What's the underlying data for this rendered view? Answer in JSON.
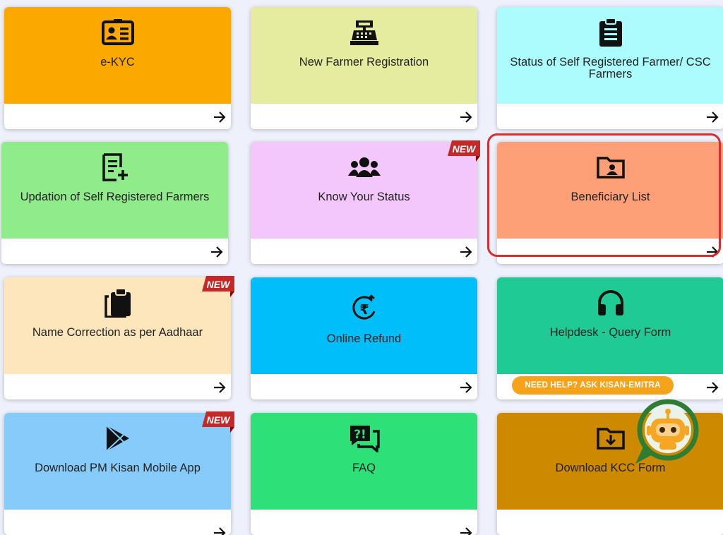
{
  "cards": [
    {
      "label": "e-KYC",
      "color": "#fba800",
      "icon": "id-card-icon"
    },
    {
      "label": "New Farmer Registration",
      "color": "#e6ec9f",
      "icon": "cash-register-icon"
    },
    {
      "label": "Status of Self Registered Farmer/ CSC Farmers",
      "color": "#adfcfd",
      "icon": "clipboard-list-icon"
    },
    {
      "label": "Updation of Self Registered Farmers",
      "color": "#90ec8a",
      "icon": "document-add-icon"
    },
    {
      "label": "Know Your Status",
      "color": "#f3c7fb",
      "icon": "users-group-icon",
      "badge": "NEW"
    },
    {
      "label": "Beneficiary List",
      "color": "#fea077",
      "icon": "folder-user-icon"
    },
    {
      "label": "Name Correction as per Aadhaar",
      "color": "#fde6bb",
      "icon": "paste-icon",
      "badge": "NEW"
    },
    {
      "label": "Online Refund",
      "color": "#00bef9",
      "icon": "rupee-refund-icon"
    },
    {
      "label": "Helpdesk - Query Form",
      "color": "#20ca94",
      "icon": "headphones-icon"
    },
    {
      "label": "Download PM Kisan Mobile App",
      "color": "#86cbfa",
      "icon": "play-store-icon",
      "badge": "NEW"
    },
    {
      "label": "FAQ",
      "color": "#2ee078",
      "icon": "faq-chat-icon"
    },
    {
      "label": "Download KCC Form",
      "color": "#cd8a00",
      "icon": "folder-download-icon"
    }
  ],
  "help_pill": "NEED HELP? ASK KISAN-EMITRA",
  "badge_text": "NEW",
  "colors": {
    "highlight": "#d32f2f",
    "badge": "#c62828",
    "bot_ring": "#2e7d32",
    "bot_face": "#f5a623"
  }
}
